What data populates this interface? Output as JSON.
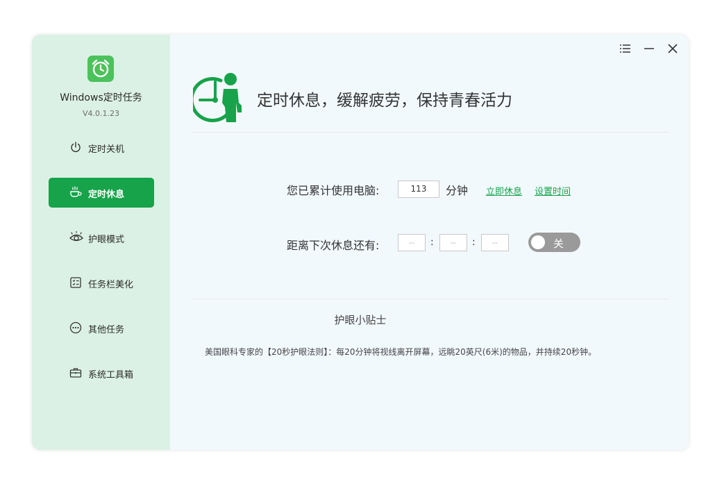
{
  "app": {
    "name": "Windows定时任务",
    "version": "V4.0.1.23"
  },
  "sidebar": {
    "items": [
      {
        "label": "定时关机",
        "icon": "power-icon",
        "active": false
      },
      {
        "label": "定时休息",
        "icon": "coffee-cup-icon",
        "active": true
      },
      {
        "label": "护眼模式",
        "icon": "eye-icon",
        "active": false
      },
      {
        "label": "任务栏美化",
        "icon": "checklist-icon",
        "active": false
      },
      {
        "label": "其他任务",
        "icon": "more-dots-icon",
        "active": false
      },
      {
        "label": "系统工具箱",
        "icon": "toolbox-icon",
        "active": false
      }
    ]
  },
  "window_controls": [
    "menu-icon",
    "minimize-icon",
    "close-icon"
  ],
  "header": {
    "title": "定时休息，缓解疲劳，保持青春活力",
    "icon": "clock-person-icon"
  },
  "usage": {
    "label": "您已累计使用电脑:",
    "value": "113",
    "unit": "分钟",
    "rest_now_link": "立即休息",
    "set_time_link": "设置时间"
  },
  "countdown": {
    "label": "距离下次休息还有:",
    "hours": "--",
    "minutes": "--",
    "seconds": "--",
    "separator": ":",
    "toggle_label": "关",
    "toggle_on": false
  },
  "tips": {
    "title": "护眼小贴士",
    "text": "美国眼科专家的【20秒护眼法则】：每20分钟将视线离开屏幕，远眺20英尺(6米)的物品，并持续20秒钟。"
  },
  "colors": {
    "accent": "#16a34a",
    "sidebar_bg": "#dcf1e5",
    "main_bg": "#f2f9fd",
    "toggle_off": "#9a9a9a"
  }
}
